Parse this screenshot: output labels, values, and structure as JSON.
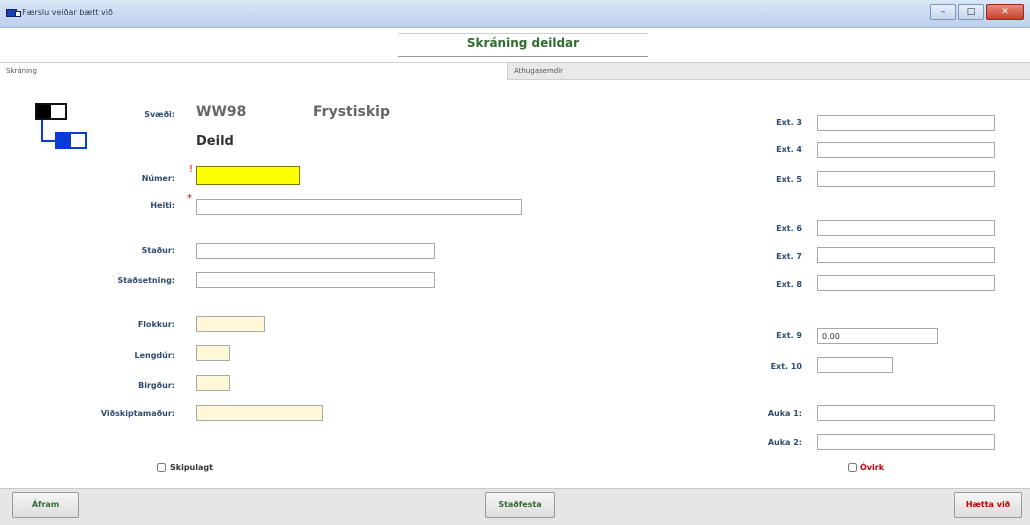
{
  "window": {
    "title": "Færslu veiðar bætt við"
  },
  "header": {
    "title": "Skráning deildar"
  },
  "tabs": [
    {
      "label": "Skráning"
    },
    {
      "label": "Athugasemdir"
    }
  ],
  "vessel": {
    "label": "Svæði:",
    "code": "WW98",
    "type": "Frystiskip",
    "section": "Deild"
  },
  "fields_left": {
    "numer": {
      "label": "Númer:",
      "value": ""
    },
    "heiti": {
      "label": "Heiti:",
      "value": ""
    },
    "stadur": {
      "label": "Staður:",
      "value": ""
    },
    "stadsetning": {
      "label": "Staðsetning:",
      "value": ""
    },
    "flokkur": {
      "label": "Flokkur:",
      "value": ""
    },
    "lengd": {
      "label": "Lengdúr:",
      "value": ""
    },
    "byrgur": {
      "label": "Birgður:",
      "value": ""
    },
    "vidskiptamadur": {
      "label": "Viðskiptamaður:",
      "value": ""
    }
  },
  "fields_right": [
    {
      "label": "Ext. 3",
      "value": ""
    },
    {
      "label": "Ext. 4",
      "value": ""
    },
    {
      "label": "Ext. 5",
      "value": ""
    },
    {
      "label": "Ext. 6",
      "value": ""
    },
    {
      "label": "Ext. 7",
      "value": ""
    },
    {
      "label": "Ext. 8",
      "value": ""
    },
    {
      "label": "Ext. 9",
      "value": "0.00"
    },
    {
      "label": "Ext. 10",
      "value": ""
    },
    {
      "label": "Auka 1:",
      "value": ""
    },
    {
      "label": "Auka 2:",
      "value": ""
    }
  ],
  "checkboxes": {
    "skipulagt": {
      "label": "Skipulagt",
      "checked": false
    },
    "ovirk": {
      "label": "Óvirk",
      "checked": false
    }
  },
  "footer": {
    "back": "Áfram",
    "confirm": "Staðfesta",
    "cancel": "Hætta við"
  },
  "colors": {
    "accent": "#2f6b2f",
    "danger": "#c20000",
    "required_field": "#ffff00",
    "readonly_field": "#fff8d8"
  }
}
